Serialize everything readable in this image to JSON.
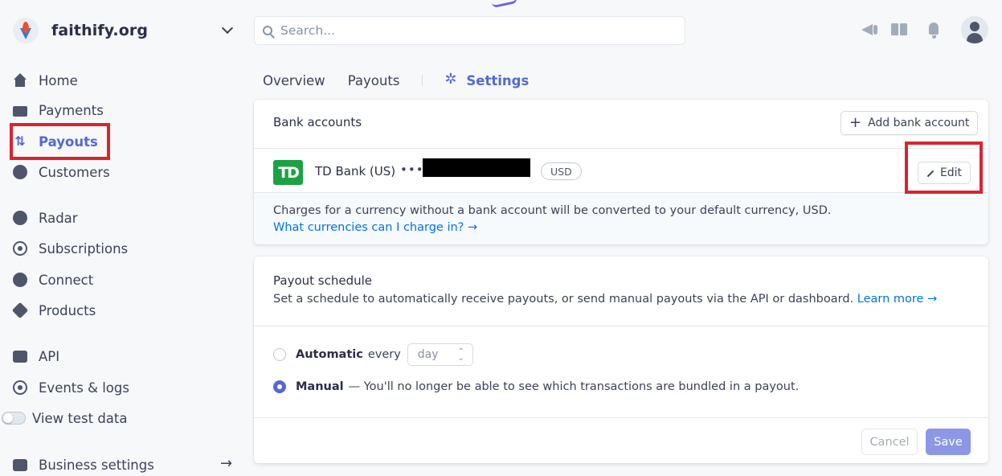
{
  "brand": {
    "name": "faithify.org"
  },
  "search": {
    "placeholder": "Search..."
  },
  "sidebar": {
    "items": [
      {
        "label": "Home"
      },
      {
        "label": "Payments"
      },
      {
        "label": "Payouts"
      },
      {
        "label": "Customers"
      },
      {
        "label": "Radar"
      },
      {
        "label": "Subscriptions"
      },
      {
        "label": "Connect"
      },
      {
        "label": "Products"
      },
      {
        "label": "API"
      },
      {
        "label": "Events & logs"
      },
      {
        "label": "View test data"
      },
      {
        "label": "Business settings"
      }
    ],
    "arrow": "→"
  },
  "tabs": [
    {
      "label": "Overview"
    },
    {
      "label": "Payouts"
    },
    {
      "label": "Settings"
    }
  ],
  "bank": {
    "heading": "Bank accounts",
    "add_label": "Add bank account",
    "add_plus": "+",
    "logo_text": "TD",
    "bank_name": "TD Bank (US)",
    "masked": "••••",
    "currency": "USD",
    "edit_label": "Edit",
    "note": "Charges for a currency without a bank account will be converted to your default currency, USD.",
    "note_link": "What currencies can I charge in? →"
  },
  "schedule": {
    "title": "Payout schedule",
    "description": "Set a schedule to automatically receive payouts, or send manual payouts via the API or dashboard.",
    "learn_more": "Learn more →",
    "automatic_label": "Automatic",
    "automatic_every": "every",
    "interval_value": "day",
    "manual_label": "Manual",
    "manual_desc": "— You'll no longer be able to see which transactions are bundled in a payout.",
    "cancel_label": "Cancel",
    "save_label": "Save"
  },
  "colors": {
    "accent": "#5469d4",
    "highlight_box": "#d72530",
    "td_green": "#1ca245",
    "link": "#0073e6"
  }
}
